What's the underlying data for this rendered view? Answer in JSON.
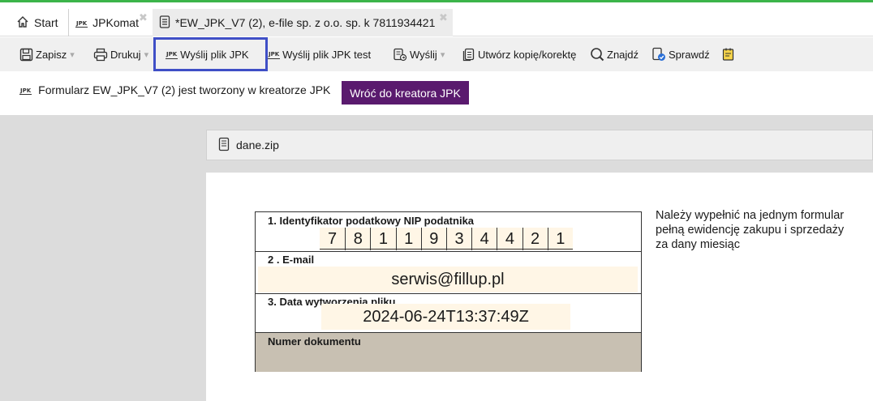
{
  "tabs": {
    "start": "Start",
    "jpkomat": "JPKomat",
    "document": "*EW_JPK_V7 (2), e-file sp. z o.o. sp. k 7811934421"
  },
  "toolbar": {
    "save": "Zapisz",
    "print": "Drukuj",
    "send_jpk": "Wyślij plik JPK",
    "send_jpk_test": "Wyślij plik JPK test",
    "send": "Wyślij",
    "create_copy": "Utwórz kopię/korektę",
    "find": "Znajdź",
    "check": "Sprawdź",
    "dropdown_glyph": "▾"
  },
  "info": {
    "text": "Formularz EW_JPK_V7 (2) jest tworzony w kreatorze JPK",
    "back_button": "Wróć do kreatora JPK"
  },
  "file": {
    "name": "dane.zip"
  },
  "form": {
    "nip_label": "1. Identyfikator podatkowy NIP podatnika",
    "nip_digits": [
      "7",
      "8",
      "1",
      "1",
      "9",
      "3",
      "4",
      "4",
      "2",
      "1"
    ],
    "email_label": "2 . E-mail",
    "email_value": "serwis@fillup.pl",
    "date_label": "3. Data wytworzenia pliku",
    "date_value": "2024-06-24T13:37:49Z",
    "doc_number_label": "Numer dokumentu"
  },
  "note": {
    "line1": "Należy wypełnić na jednym formular",
    "line2": "pełną ewidencję zakupu i sprzedaży",
    "line3": "za dany miesiąc"
  },
  "colors": {
    "accent_green": "#3cb44a",
    "back_button": "#5a1a6e",
    "highlight_border": "#3f4fc6",
    "field_fill": "#fff6e6",
    "doc_number_fill": "#c8c0b2"
  },
  "icons": {
    "start": "home-icon",
    "jpk": "jpk-icon",
    "document": "document-icon",
    "save": "floppy-icon",
    "print": "printer-icon",
    "send": "send-file-icon",
    "copy": "copy-icon",
    "find": "magnifier-icon",
    "check": "check-document-icon",
    "note": "sticky-note-icon",
    "file": "zip-file-icon"
  }
}
